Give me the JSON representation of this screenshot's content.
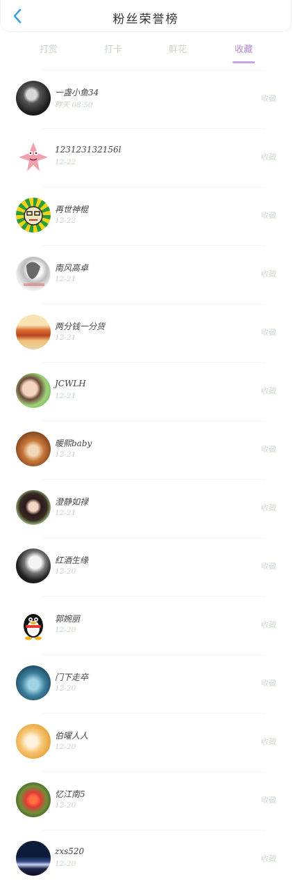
{
  "header": {
    "title": "粉丝荣誉榜"
  },
  "tabs": [
    {
      "label": "打赏",
      "active": false
    },
    {
      "label": "打卡",
      "active": false
    },
    {
      "label": "鲜花",
      "active": false
    },
    {
      "label": "收藏",
      "active": true
    }
  ],
  "fans": [
    {
      "name": "一盏小鱼34",
      "time": "昨天 08:50",
      "action": "收藏",
      "avatar": "dark-portrait-avatar"
    },
    {
      "name": "123123132156l",
      "time": "12-22",
      "action": "收藏",
      "avatar": "patrick-star-avatar"
    },
    {
      "name": "再世神棍",
      "time": "12-22",
      "action": "收藏",
      "avatar": "cartoon-face-avatar"
    },
    {
      "name": "南风高卓",
      "time": "12-21",
      "action": "收藏",
      "avatar": "sketch-portrait-avatar"
    },
    {
      "name": "两分钱一分货",
      "time": "12-21",
      "action": "收藏",
      "avatar": "food-avatar"
    },
    {
      "name": "JCWLH",
      "time": "12-21",
      "action": "收藏",
      "avatar": "child-portrait-avatar"
    },
    {
      "name": "暖熙baby",
      "time": "12-21",
      "action": "收藏",
      "avatar": "puppy-avatar"
    },
    {
      "name": "澄静如禄",
      "time": "12-21",
      "action": "收藏",
      "avatar": "girl-portrait-avatar"
    },
    {
      "name": "红酒生缘",
      "time": "12-20",
      "action": "收藏",
      "avatar": "bw-portrait-avatar"
    },
    {
      "name": "郭婉丽",
      "time": "12-20",
      "action": "收藏",
      "avatar": "qq-penguin-avatar"
    },
    {
      "name": "门下走卒",
      "time": "12-20",
      "action": "收藏",
      "avatar": "blue-scene-avatar"
    },
    {
      "name": "伯曜人人",
      "time": "12-20",
      "action": "收藏",
      "avatar": "fox-avatar"
    },
    {
      "name": "忆江南5",
      "time": "12-20",
      "action": "收藏",
      "avatar": "flowers-avatar"
    },
    {
      "name": "zxs520",
      "time": "12-20",
      "action": "收藏",
      "avatar": "night-city-avatar"
    }
  ],
  "colors": {
    "back_arrow": "#3ba0e6",
    "tab_active": "#b38ad6",
    "tab_underline": "#c7a4e6",
    "tab_inactive": "#c8d8c8"
  }
}
